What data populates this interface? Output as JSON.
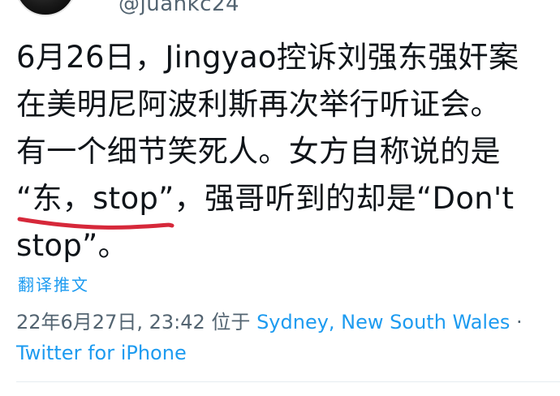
{
  "header": {
    "handle": "@juankc24"
  },
  "tweet": {
    "line1": "6月26日，Jingyao控诉刘强东强奸案",
    "line2": "在美明尼阿波利斯再次举行听证会。",
    "line3": "有一个细节笑死人。女方自称说的是",
    "line4_quote": "“东，stop”",
    "line4_rest": "，强哥听到的却是“Don't",
    "line5": "stop”。"
  },
  "translate_label": "翻译推文",
  "meta": {
    "datetime": "22年6月27日, 23:42",
    "location_prefix": "位于",
    "location": "Sydney, New South Wales",
    "separator": "·",
    "source": "Twitter for iPhone"
  },
  "colors": {
    "link": "#1d9bf0",
    "secondary_text": "#536471",
    "annotation_underline": "#d6283a"
  }
}
